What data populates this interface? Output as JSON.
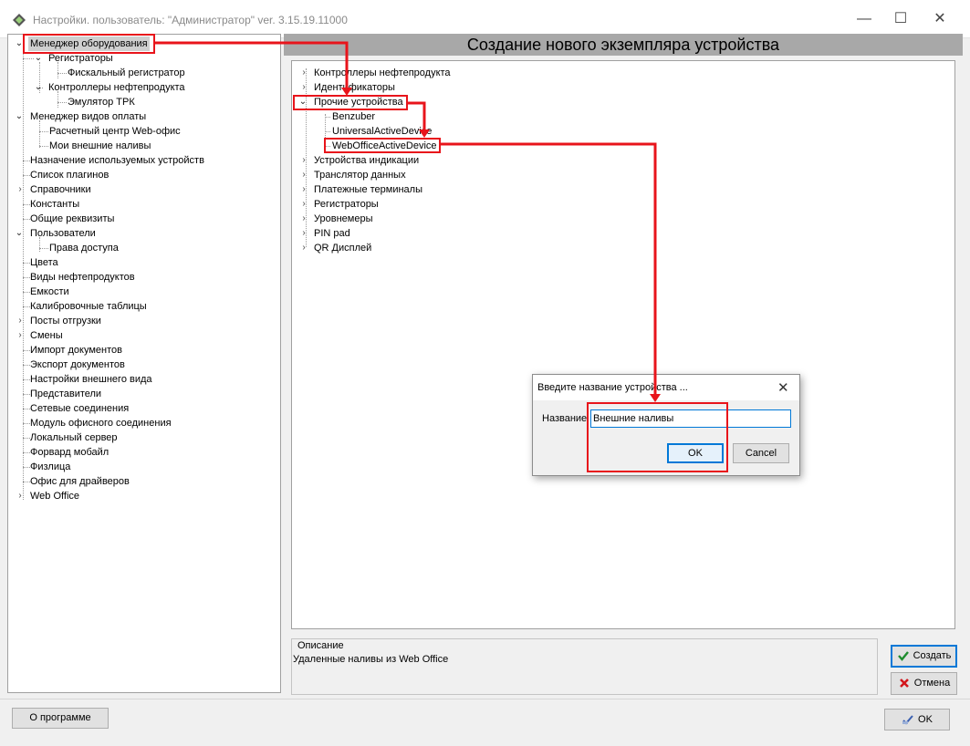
{
  "window": {
    "title": "Настройки. пользователь: \"Администратор\" ver. 3.15.19.11000",
    "min_label": "—",
    "max_label": "☐",
    "close_label": "✕"
  },
  "left_tree": {
    "equipment_manager": "Менеджер оборудования",
    "registrators": "Регистраторы",
    "fiscal_registrar": "Фискальный регистратор",
    "fuel_controllers": "Контроллеры нефтепродукта",
    "trk_emulator": "Эмулятор ТРК",
    "payment_manager": "Менеджер видов оплаты",
    "webof_settlement": "Расчетный центр Web-офис",
    "my_external_pours": "Мои внешние наливы",
    "used_devices": "Назначение используемых устройств",
    "plugin_list": "Список плагинов",
    "directories": "Справочники",
    "constants": "Константы",
    "common_details": "Общие реквизиты",
    "users": "Пользователи",
    "access_rights": "Права доступа",
    "colors": "Цвета",
    "fuel_types": "Виды нефтепродуктов",
    "tanks": "Емкости",
    "calibration_tables": "Калибровочные таблицы",
    "dispatch_posts": "Посты отгрузки",
    "shifts": "Смены",
    "import_docs": "Импорт документов",
    "export_docs": "Экспорт документов",
    "appearance": "Настройки внешнего вида",
    "representatives": "Представители",
    "network_connections": "Сетевые соединения",
    "office_connection": "Модуль офисного соединения",
    "local_server": "Локальный сервер",
    "forward_mobile": "Форвард мобайл",
    "individuals": "Физлица",
    "driver_office": "Офис для драйверов",
    "web_office": "Web Office"
  },
  "right_header": "Создание нового экземпляра устройства",
  "device_tree": {
    "fuel_controllers": "Контроллеры нефтепродукта",
    "identifiers": "Идентификаторы",
    "other_devices": "Прочие устройства",
    "benzuber": "Benzuber",
    "universal_active": "UniversalActiveDevice",
    "weboffice_active": "WebOfficeActiveDevice",
    "display_devices": "Устройства индикации",
    "data_translator": "Транслятор данных",
    "payment_terminals": "Платежные терминалы",
    "registrators": "Регистраторы",
    "level_gauges": "Уровнемеры",
    "pin_pad": "PIN pad",
    "qr_display": "QR Дисплей"
  },
  "description": {
    "legend": "Описание",
    "text": "Удаленные наливы из Web Office"
  },
  "buttons": {
    "create": "Создать",
    "cancel": "Отмена",
    "about": "О программе",
    "ok": "OK"
  },
  "dialog": {
    "title": "Введите название устройства ...",
    "name_label": "Название",
    "name_value": "Внешние наливы",
    "ok": "OK",
    "cancel": "Cancel",
    "close": "✕"
  },
  "colors": {
    "annotation_red": "#e8141b",
    "header_gray": "#a8a8a8",
    "focus_blue": "#0078d7"
  }
}
